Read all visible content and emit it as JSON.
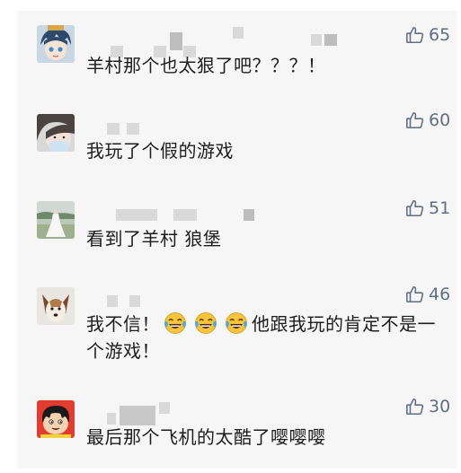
{
  "comments": [
    {
      "text": "羊村那个也太狠了吧？？？！",
      "likes": "65",
      "avatar": "anime-character-icon"
    },
    {
      "text": "我玩了个假的游戏",
      "likes": "60",
      "avatar": "person-face-icon"
    },
    {
      "text": "看到了羊村 狼堡",
      "likes": "51",
      "avatar": "wedding-photo-icon"
    },
    {
      "text_before": "我不信！",
      "emojis": [
        "laughing-tears-emoji",
        "laughing-tears-emoji",
        "laughing-tears-emoji"
      ],
      "text_after": "他跟我玩的肯定不是一个游戏！",
      "likes": "46",
      "avatar": "dog-icon"
    },
    {
      "text": "最后那个飞机的太酷了嘤嘤嘤",
      "likes": "30",
      "avatar": "cartoon-boy-icon"
    }
  ],
  "colors": {
    "background": "#f6f6f6",
    "like": "#5f6f85",
    "text": "#1d1d1d"
  },
  "icons": {
    "like": "thumbs-up-icon"
  }
}
